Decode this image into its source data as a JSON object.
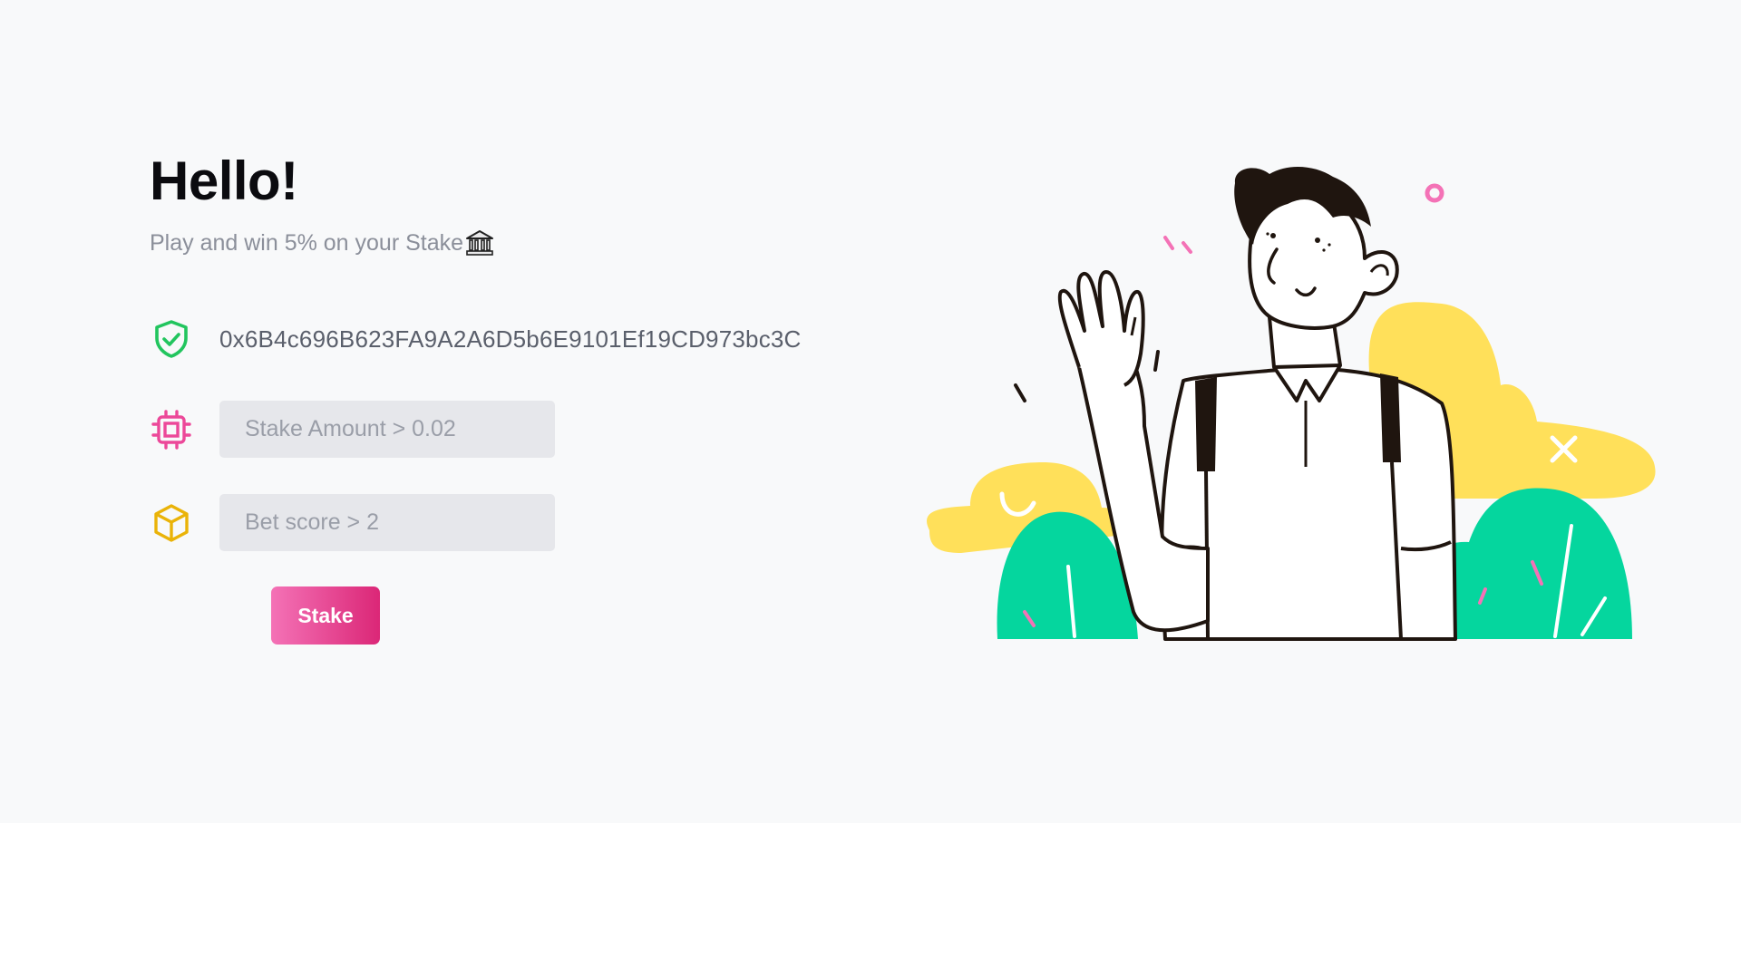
{
  "header": {
    "title": "Hello!",
    "subtitle": "Play and win 5% on your Stake"
  },
  "icons": {
    "subtitle_icon": "bank-icon",
    "wallet_icon": "shield-check-icon",
    "amount_icon": "chip-icon",
    "score_icon": "cube-icon",
    "illustration": "waving-man-illustration"
  },
  "wallet": {
    "address": "0x6B4c696B623FA9A2A6D5b6E9101Ef19CD973bc3C"
  },
  "form": {
    "stake_amount_placeholder": "Stake Amount > 0.02",
    "bet_score_placeholder": "Bet score > 2",
    "submit_label": "Stake"
  },
  "colors": {
    "accent_pink": "#db2777",
    "accent_pink_light": "#f472b6",
    "success_green": "#22c55e",
    "amber": "#eab308",
    "foliage_green": "#05d69e",
    "cloud_yellow": "#ffe05a",
    "background": "#f8f9fa"
  }
}
